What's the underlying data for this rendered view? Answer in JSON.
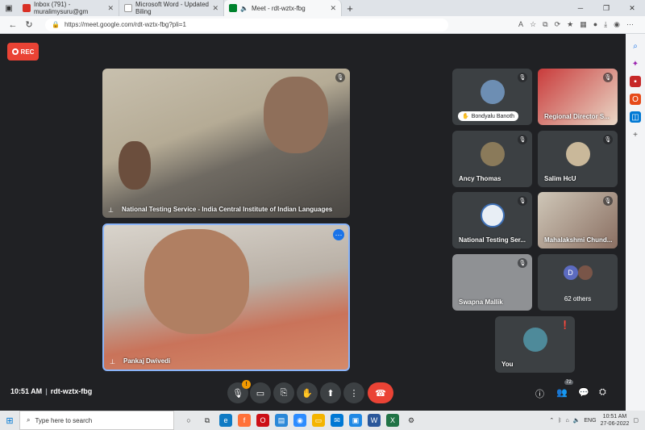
{
  "browser": {
    "tabs": [
      {
        "title": "Inbox (791) - muralimysuru@gm",
        "color": "#d93025"
      },
      {
        "title": "Microsoft Word - Updated Biling",
        "color": "#ffffff"
      },
      {
        "title": "Meet - rdt-wztx-fbg",
        "color": "#00832d",
        "active": true
      }
    ],
    "url": "https://meet.google.com/rdt-wztx-fbg?pli=1"
  },
  "meet": {
    "rec_label": "REC",
    "main_tiles": [
      {
        "name": "National Testing Service - India Central Institute of Indian Languages"
      },
      {
        "name": "Pankaj Dwivedi"
      }
    ],
    "side_tiles": [
      {
        "name": "Bondyalu Banoth"
      },
      {
        "name": "Regional Director S..."
      },
      {
        "name": "Ancy Thomas"
      },
      {
        "name": "Salim HcU"
      },
      {
        "name": "National Testing Ser..."
      },
      {
        "name": "Mahalakshmi Chund..."
      },
      {
        "name": "Swapna Mallik"
      },
      {
        "name": "62 others",
        "avatar_letter": "D"
      }
    ],
    "self_tile": {
      "name": "You"
    },
    "time": "10:51 AM",
    "meeting_code": "rdt-wztx-fbg",
    "mic_badge": "!",
    "participants_count": "72"
  },
  "taskbar": {
    "search_placeholder": "Type here to search",
    "language": "ENG",
    "time": "10:51 AM",
    "date": "27-06-2022"
  },
  "colors": {
    "accent_red": "#ea4335",
    "accent_blue": "#1a73e8",
    "meet_bg": "#202124",
    "tile_bg": "#3c4043"
  }
}
